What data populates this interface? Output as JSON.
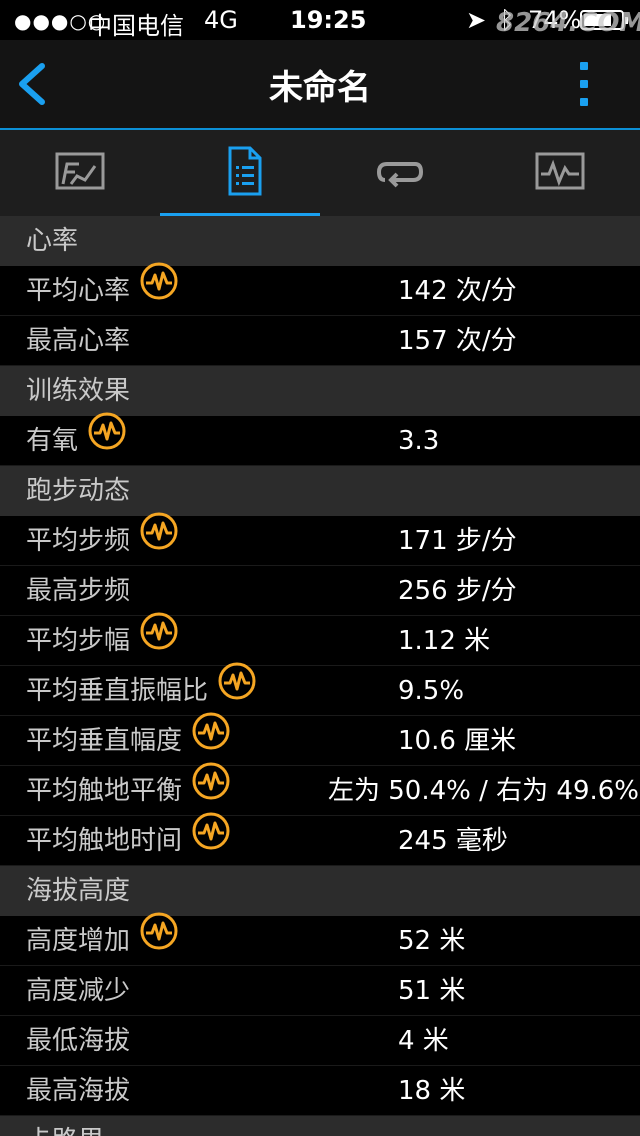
{
  "status_bar": {
    "signal": "●●●○○",
    "carrier": "中国电信",
    "network": "4G",
    "time": "19:25",
    "location_icon": "location-arrow-icon",
    "bluetooth_icon": "bluetooth-icon",
    "battery_text": "74%",
    "battery_level": 0.74,
    "watermark": "8264.COM"
  },
  "nav": {
    "title": "未命名",
    "back_icon": "chevron-left-icon",
    "more_icon": "more-vertical-icon"
  },
  "tabs": [
    {
      "icon": "activity-summary-icon",
      "active": false
    },
    {
      "icon": "details-list-icon",
      "active": true
    },
    {
      "icon": "laps-loop-icon",
      "active": false
    },
    {
      "icon": "charts-icon",
      "active": false
    }
  ],
  "colors": {
    "accent": "#1aa0f0",
    "hr_badge": "#f5a623",
    "section_bg": "#2c2c2c"
  },
  "sections": {
    "heart_rate": {
      "title": "心率",
      "rows": [
        {
          "label": "平均心率",
          "value": "142 次/分",
          "hr_icon": true
        },
        {
          "label": "最高心率",
          "value": "157 次/分",
          "hr_icon": false
        }
      ]
    },
    "training_effect": {
      "title": "训练效果",
      "rows": [
        {
          "label": "有氧",
          "value": "3.3",
          "hr_icon": true
        }
      ]
    },
    "running_dynamics": {
      "title": "跑步动态",
      "rows": [
        {
          "label": "平均步频",
          "value": "171 步/分",
          "hr_icon": true
        },
        {
          "label": "最高步频",
          "value": "256 步/分",
          "hr_icon": false
        },
        {
          "label": "平均步幅",
          "value": "1.12 米",
          "hr_icon": true
        },
        {
          "label": "平均垂直振幅比",
          "value": "9.5%",
          "hr_icon": true
        },
        {
          "label": "平均垂直幅度",
          "value": "10.6 厘米",
          "hr_icon": true
        },
        {
          "label": "平均触地平衡",
          "value": "左为 50.4% / 右为 49.6%",
          "hr_icon": true
        },
        {
          "label": "平均触地时间",
          "value": "245 毫秒",
          "hr_icon": true
        }
      ]
    },
    "elevation": {
      "title": "海拔高度",
      "rows": [
        {
          "label": "高度增加",
          "value": "52 米",
          "hr_icon": true
        },
        {
          "label": "高度减少",
          "value": "51 米",
          "hr_icon": false
        },
        {
          "label": "最低海拔",
          "value": "4 米",
          "hr_icon": false
        },
        {
          "label": "最高海拔",
          "value": "18 米",
          "hr_icon": false
        }
      ]
    },
    "next": {
      "title": "卡路里"
    }
  }
}
